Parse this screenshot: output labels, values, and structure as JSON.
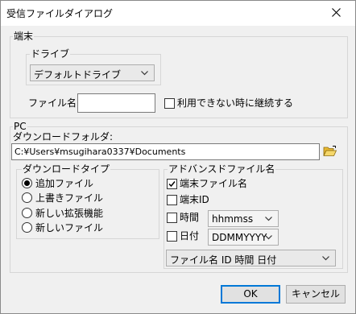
{
  "window": {
    "title": "受信ファイルダイアログ"
  },
  "terminal": {
    "group_label": "端末",
    "drive_label": "ドライブ",
    "drive_value": "デフォルトドライブ",
    "filename_label": "ファイル名:",
    "filename_value": "",
    "continue_label": "利用できない時に継続する",
    "continue_checked": false
  },
  "pc": {
    "group_label": "PC",
    "folder_label": "ダウンロードフォルダ:",
    "folder_value": "C:¥Users¥msugihara0337¥Documents"
  },
  "download_type": {
    "label": "ダウンロードタイプ",
    "options": [
      "追加ファイル",
      "上書きファイル",
      "新しい拡張機能",
      "新しいファイル"
    ],
    "selected": "追加ファイル"
  },
  "advanced": {
    "label": "アドバンスドファイル名",
    "terminal_filename_label": "端末ファイル名",
    "terminal_filename_checked": true,
    "terminal_id_label": "端末ID",
    "terminal_id_checked": false,
    "time_label": "時間",
    "time_checked": false,
    "time_format": "hhmmss",
    "date_label": "日付",
    "date_checked": false,
    "date_format": "DDMMYYYY",
    "order_value": "ファイル名 ID 時間 日付"
  },
  "buttons": {
    "ok": "OK",
    "cancel": "キャンセル"
  }
}
